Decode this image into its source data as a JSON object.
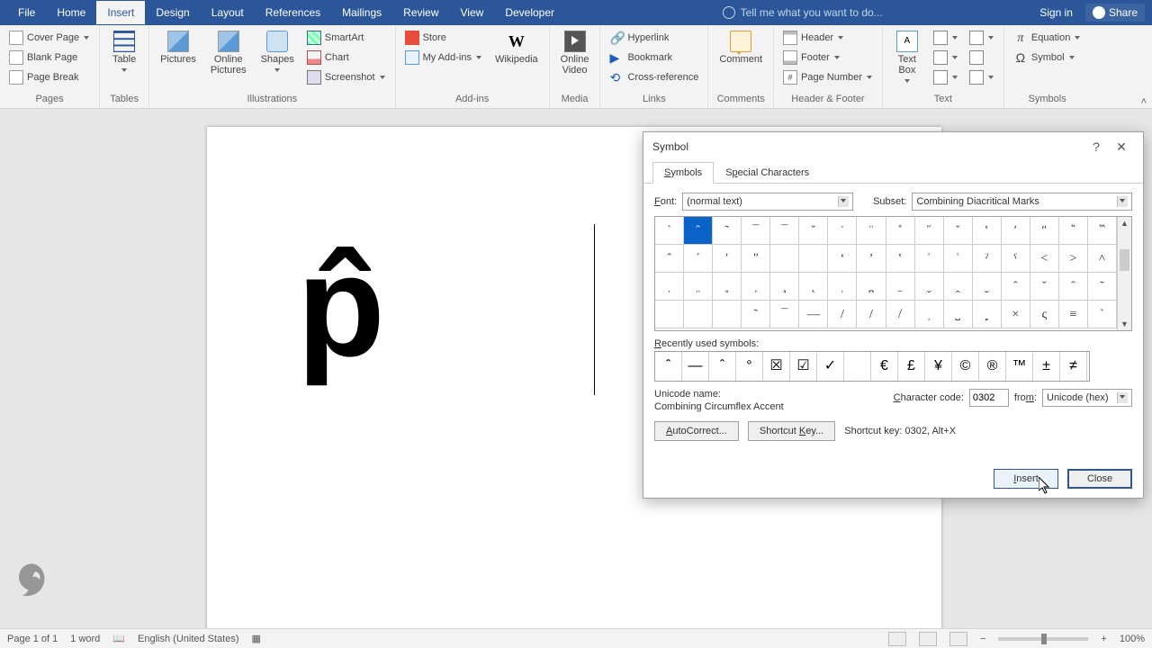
{
  "menubar": {
    "tabs": [
      "File",
      "Home",
      "Insert",
      "Design",
      "Layout",
      "References",
      "Mailings",
      "Review",
      "View",
      "Developer"
    ],
    "active_index": 2,
    "tell_me": "Tell me what you want to do...",
    "sign_in": "Sign in",
    "share": "Share"
  },
  "ribbon": {
    "pages": {
      "label": "Pages",
      "cover": "Cover Page",
      "blank": "Blank Page",
      "break": "Page Break"
    },
    "tables": {
      "label": "Tables",
      "table": "Table"
    },
    "illustrations": {
      "label": "Illustrations",
      "pictures": "Pictures",
      "online_pics": "Online\nPictures",
      "shapes": "Shapes",
      "smartart": "SmartArt",
      "chart": "Chart",
      "screenshot": "Screenshot"
    },
    "addins": {
      "label": "Add-ins",
      "store": "Store",
      "my": "My Add-ins",
      "wiki": "Wikipedia"
    },
    "media": {
      "label": "Media",
      "video": "Online\nVideo"
    },
    "links": {
      "label": "Links",
      "hyper": "Hyperlink",
      "book": "Bookmark",
      "cross": "Cross-reference"
    },
    "comments": {
      "label": "Comments",
      "comment": "Comment"
    },
    "hf": {
      "label": "Header & Footer",
      "header": "Header",
      "footer": "Footer",
      "pagenum": "Page Number"
    },
    "text": {
      "label": "Text",
      "textbox": "Text\nBox"
    },
    "symbols": {
      "label": "Symbols",
      "equation": "Equation",
      "symbol": "Symbol"
    }
  },
  "document": {
    "text": "p̂"
  },
  "dialog": {
    "title": "Symbol",
    "tab_symbols": "Symbols",
    "tab_special": "Special Characters",
    "font_label": "Font:",
    "font_value": "(normal text)",
    "subset_label": "Subset:",
    "subset_value": "Combining Diacritical Marks",
    "grid": [
      [
        "ˋ",
        "ˆ",
        "˜",
        "¯",
        "¯",
        "˘",
        "˙",
        "¨",
        "˚",
        "˝",
        "ˇ",
        "‛",
        "′",
        "″",
        "‶",
        "‷"
      ],
      [
        "ˆ",
        "´",
        "ʹ",
        "ʺ",
        " ",
        " ",
        "ʻ",
        "ʼ",
        "ʽ",
        "ʾ",
        "ʿ",
        "ˀ",
        "ˁ",
        "˂",
        "˃",
        "˄"
      ],
      [
        "̣",
        "̤",
        "̥",
        "̦",
        "̧",
        "̨",
        "̩",
        "̪",
        "̫",
        "̬",
        "̭",
        "̮",
        "ˆ",
        "ˇ",
        "ˆ",
        "˜"
      ],
      [
        " ",
        " ",
        " ",
        "˜",
        "¯",
        "—",
        "/",
        "/",
        "̸",
        "̹",
        "̺",
        "̻",
        "×",
        "ς",
        "≡",
        "`"
      ]
    ],
    "selected_row": 0,
    "selected_col": 1,
    "recent_label": "Recently used symbols:",
    "recent": [
      "ˆ",
      "—",
      "ˆ",
      "°",
      "☒",
      "☑",
      "✓",
      " ",
      "€",
      "£",
      "¥",
      "©",
      "®",
      "™",
      "±",
      "≠"
    ],
    "unicode_name_label": "Unicode name:",
    "unicode_name": "Combining Circumflex Accent",
    "char_code_label": "Character code:",
    "char_code": "0302",
    "from_label": "from:",
    "from_value": "Unicode (hex)",
    "autocorrect": "AutoCorrect...",
    "shortcut_key_btn": "Shortcut Key...",
    "shortcut_label": "Shortcut key: 0302, Alt+X",
    "insert": "Insert",
    "close": "Close"
  },
  "statusbar": {
    "page": "Page 1 of 1",
    "words": "1 word",
    "lang": "English (United States)",
    "zoom": "100%"
  }
}
